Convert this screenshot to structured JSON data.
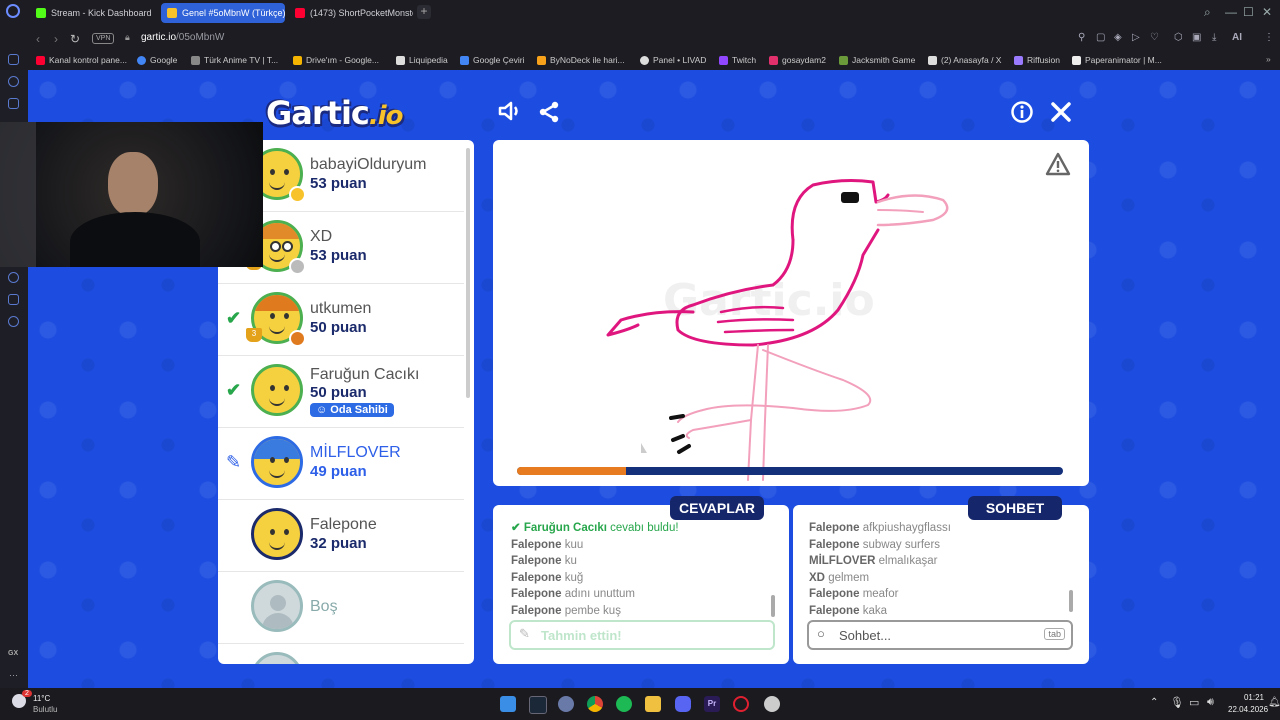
{
  "browser": {
    "tabs": [
      {
        "title": "Stream - Kick Dashboard",
        "icon": "kick-icon",
        "color": "#53fc18"
      },
      {
        "title": "Genel #5oMbnW (Türkçe)",
        "icon": "gartic-icon",
        "color": "#f7c22a"
      },
      {
        "title": "(1473) ShortPocketMonste",
        "icon": "youtube-icon",
        "color": "#ff0033"
      }
    ],
    "new_tab": "+",
    "vpn_label": "VPN",
    "url_host": "gartic.io",
    "url_path": "/05oMbnW",
    "ai_label": "AI",
    "bookmarks": [
      {
        "label": "Kanal kontrol pane...",
        "color": "#ff0033"
      },
      {
        "label": "Google",
        "color": "#4285f4"
      },
      {
        "label": "Türk Anime TV | T...",
        "color": "#888888"
      },
      {
        "label": "Drive'ım - Google...",
        "color": "#f4b400"
      },
      {
        "label": "Liquipedia",
        "color": "#dddddd"
      },
      {
        "label": "Google Çeviri",
        "color": "#4285f4"
      },
      {
        "label": "ByNoDeck ile hari...",
        "color": "#f7a21a"
      },
      {
        "label": "Panel • LIVAD",
        "color": "#dddddd"
      },
      {
        "label": "Twitch",
        "color": "#9146ff"
      },
      {
        "label": "gosaydam2",
        "color": "#e1306c"
      },
      {
        "label": "Jacksmith Game",
        "color": "#6a9a3a"
      },
      {
        "label": "(2) Anasayfa / X",
        "color": "#dddddd"
      },
      {
        "label": "Riffusion",
        "color": "#9a7aff"
      },
      {
        "label": "Paperanimator | M...",
        "color": "#eeeeee"
      }
    ]
  },
  "game": {
    "logo_main": "Gartic",
    "logo_suffix": ".io",
    "players": [
      {
        "name": "babayiOlduryum",
        "score": "53 puan",
        "status": "",
        "badge_color": "#f7c22a",
        "rank": ""
      },
      {
        "name": "XD",
        "score": "53 puan",
        "status": "",
        "badge_color": "#bbbbbb",
        "rank": ""
      },
      {
        "name": "utkumen",
        "score": "50 puan",
        "status": "found",
        "badge_color": "#e07a1f",
        "rank": "3"
      },
      {
        "name": "Faruğun Cacıkı",
        "score": "50 puan",
        "status": "found",
        "badge_color": "",
        "rank": "",
        "tag": "Oda Sahibi"
      },
      {
        "name": "MİLFLOVER",
        "score": "49 puan",
        "status": "drawing",
        "badge_color": "",
        "rank": ""
      },
      {
        "name": "Falepone",
        "score": "32 puan",
        "status": "",
        "badge_color": "",
        "rank": ""
      },
      {
        "name": "Boş",
        "score": "",
        "status": "empty",
        "badge_color": "",
        "rank": ""
      }
    ],
    "timer_progress_pct": 20,
    "answers_header": "CEVAPLAR",
    "chat_header": "SOHBET",
    "answers": [
      {
        "user": "Faruğun Cacıkı",
        "text": "cevabı buldu!",
        "found": true
      },
      {
        "user": "Falepone",
        "text": "kuu"
      },
      {
        "user": "Falepone",
        "text": "ku"
      },
      {
        "user": "Falepone",
        "text": "kuğ"
      },
      {
        "user": "Falepone",
        "text": "adını unuttum"
      },
      {
        "user": "Falepone",
        "text": "pembe kuş"
      }
    ],
    "chat": [
      {
        "user": "Falepone",
        "text": "afkpiushaygflassı"
      },
      {
        "user": "Falepone",
        "text": "subway surfers"
      },
      {
        "user": "MİLFLOVER",
        "text": "elmalıkaşar"
      },
      {
        "user": "XD",
        "text": "gelmem"
      },
      {
        "user": "Falepone",
        "text": "meafor"
      },
      {
        "user": "Falepone",
        "text": "kaka"
      }
    ],
    "guess_placeholder": "Tahmin ettin!",
    "chat_placeholder": "Sohbet...",
    "tab_key": "tab",
    "watermark": "Gartic.io"
  },
  "taskbar": {
    "weather_temp": "11°C",
    "weather_desc": "Bulutlu",
    "weather_badge": "2",
    "time": "01:21",
    "date": "22.04.2026"
  }
}
